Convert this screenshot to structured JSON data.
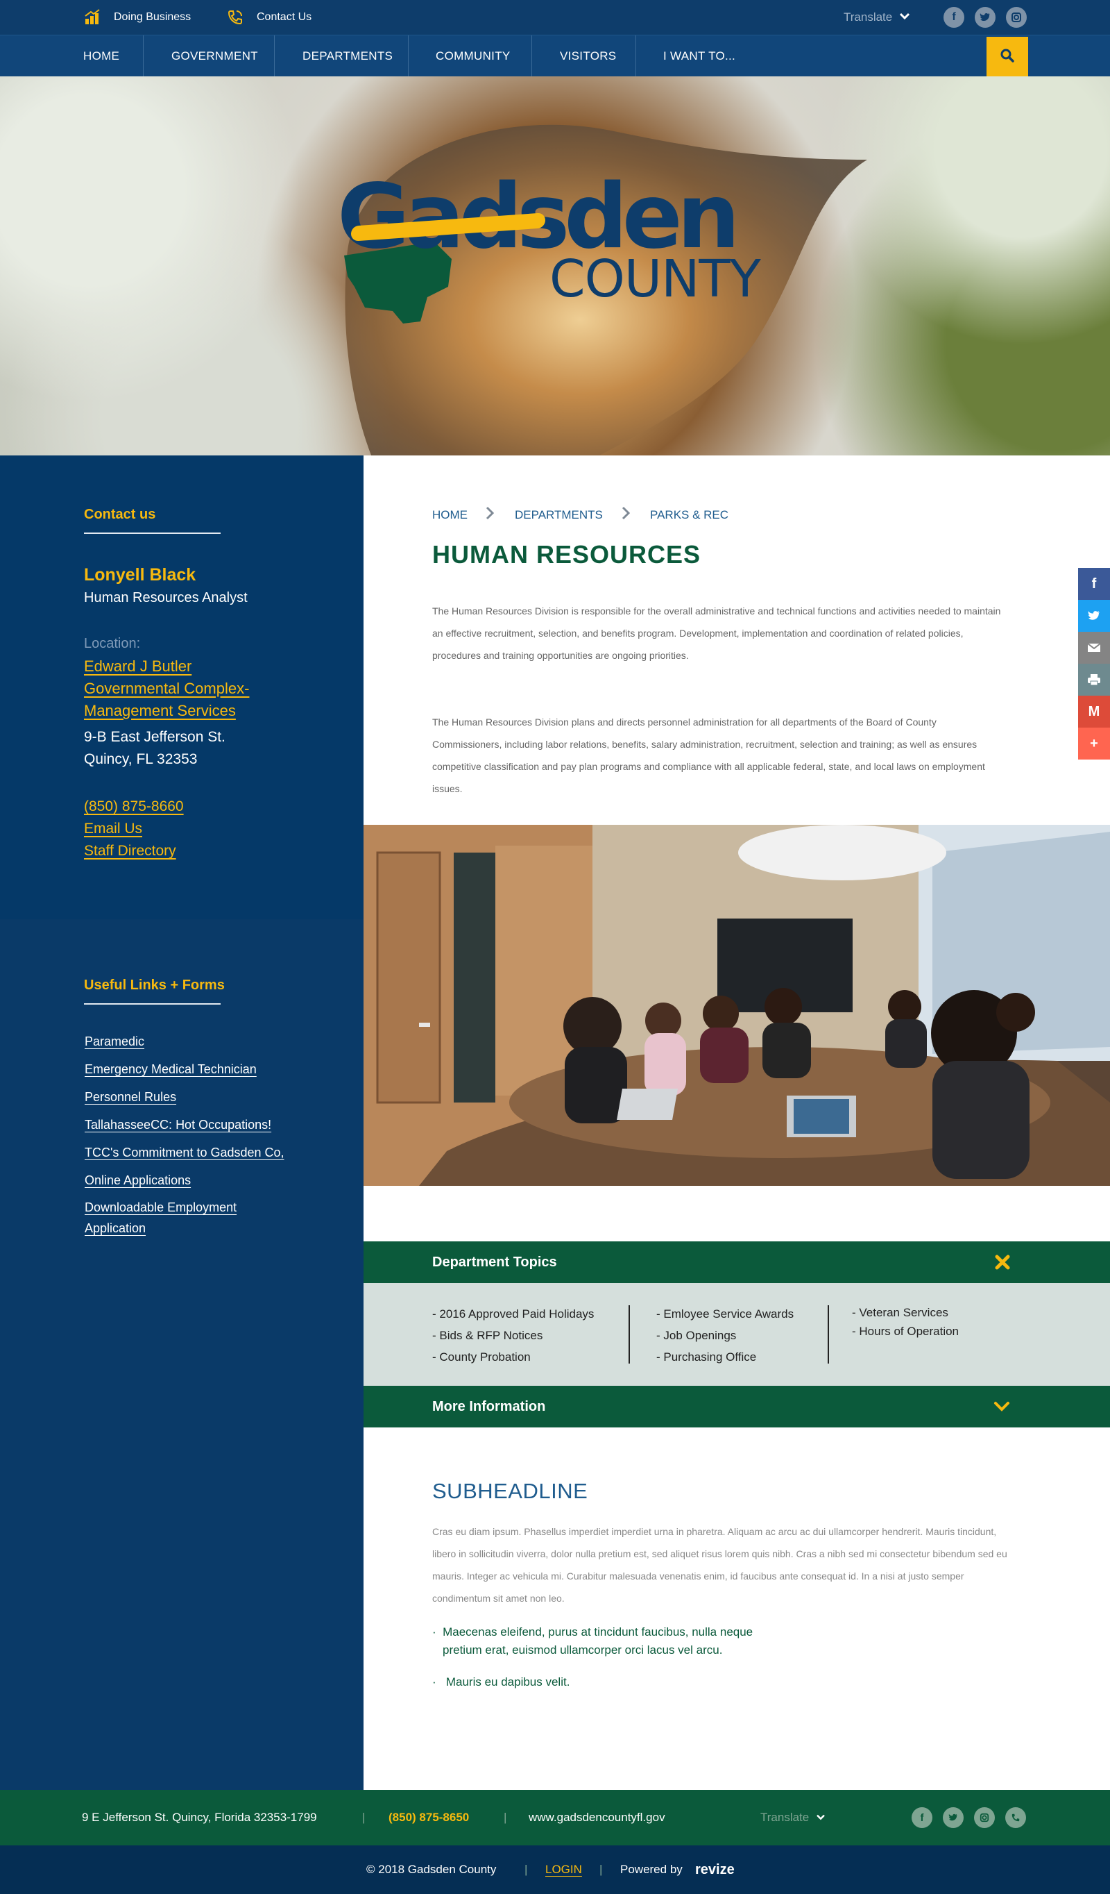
{
  "topbar": {
    "doing_business": "Doing Business",
    "contact_us": "Contact Us",
    "translate": "Translate"
  },
  "nav": {
    "items": [
      "HOME",
      "GOVERNMENT",
      "DEPARTMENTS",
      "COMMUNITY",
      "VISITORS",
      "I WANT TO..."
    ]
  },
  "hero": {
    "logo_line1": "Gadsden",
    "logo_line2": "COUNTY"
  },
  "contact": {
    "heading": "Contact us",
    "name": "Lonyell Black",
    "title": "Human Resources Analyst",
    "location_label": "Location:",
    "location_link": [
      "Edward J Butler",
      "Governmental Complex-",
      "Management Services"
    ],
    "address_line1": "9-B East Jefferson St.",
    "address_line2": "Quincy, FL 32353",
    "phone": "(850) 875-8660",
    "email": "Email Us",
    "directory": "Staff Directory"
  },
  "useful_links": {
    "heading": "Useful Links + Forms",
    "items": [
      "Paramedic",
      "Emergency Medical Technician",
      "Personnel Rules",
      "TallahasseeCC: Hot Occupations!",
      "TCC's Commitment to Gadsden Co,",
      "Online Applications",
      "Downloadable Employment",
      "Application"
    ]
  },
  "breadcrumb": [
    "HOME",
    "DEPARTMENTS",
    "PARKS & REC"
  ],
  "page_title": "HUMAN RESOURCES",
  "intro": {
    "p1": "The Human Resources Division is responsible for the overall administrative and technical functions and activities needed to maintain an effective recruitment, selection, and benefits program. Development, implementation and coordination of related policies, procedures and training opportunities are ongoing priorities.",
    "p2": "The Human Resources Division plans and directs personnel administration for all departments of the Board of County Commissioners, including labor relations, benefits, salary administration, recruitment, selection and training; as well as ensures competitive classification and pay plan programs and compliance with all applicable federal, state, and local laws on employment issues."
  },
  "topics": {
    "heading": "Department Topics",
    "col1": [
      "-  2016 Approved Paid Holidays",
      "- Bids & RFP Notices",
      "- County Probation"
    ],
    "col2": [
      "-  Emloyee Service Awards",
      "-  Job Openings",
      "- Purchasing Office"
    ],
    "col3": [
      "- Veteran Services",
      "- Hours of Operation"
    ]
  },
  "more_info": {
    "heading": "More Information"
  },
  "sub": {
    "headline": "SUBHEADLINE",
    "body": "Cras eu diam ipsum. Phasellus imperdiet imperdiet urna in pharetra. Aliquam ac arcu ac dui ullamcorper hendrerit. Mauris tincidunt, libero in sollicitudin viverra, dolor nulla pretium est, sed aliquet risus lorem quis nibh. Cras a nibh sed mi consectetur bibendum sed eu mauris. Integer ac vehicula mi. Curabitur malesuada venenatis enim, id faucibus ante consequat id. In a nisi at justo semper condimentum sit amet non leo.",
    "bullet1_line1": "Maecenas eleifend, purus at tincidunt faucibus, nulla neque",
    "bullet1_line2": "pretium erat, euismod ullamcorper orci lacus vel arcu.",
    "bullet2": "Mauris eu dapibus velit."
  },
  "footer": {
    "address": "9 E Jefferson St. Quincy, Florida 32353-1799",
    "phone": "(850) 875-8650",
    "website": "www.gadsdencountyfl.gov",
    "translate": "Translate",
    "copyright": "© 2018 Gadsden County",
    "login": "LOGIN",
    "powered_by": "Powered by",
    "brand": "revize"
  },
  "colors": {
    "navy": "#0e3d6b",
    "green": "#0b5a3b",
    "yellow": "#f7b90f"
  }
}
